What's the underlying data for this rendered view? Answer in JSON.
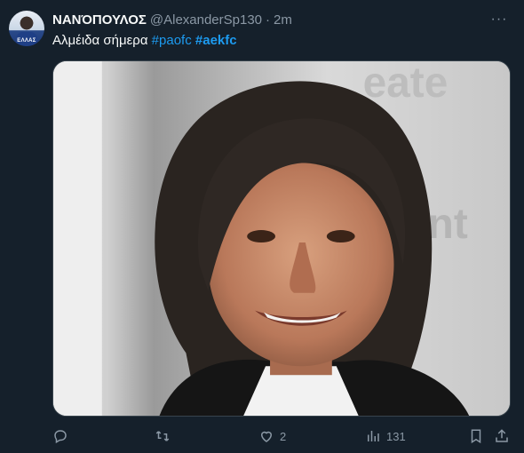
{
  "tweet": {
    "author_name": "ΝΑΝΌΠΟΥΛΟΣ",
    "handle": "@AlexanderSp130",
    "separator": "·",
    "time": "2m",
    "text_main": "Αλμέιδα σήμερα ",
    "hashtag_1": "#paofc",
    "hashtag_2": "#aekfc",
    "avatar_badge": "ΕΛΛΑΣ",
    "more_label": "···"
  },
  "media": {
    "description_icon": "photo-of-smiling-man-with-long-hair"
  },
  "actions": {
    "reply_count": "",
    "retweet_count": "",
    "like_count": "2",
    "views_count": "131"
  },
  "colors": {
    "background": "#15202b",
    "text": "#f7f9f9",
    "muted": "#8b98a5",
    "link": "#1d9bf0"
  }
}
